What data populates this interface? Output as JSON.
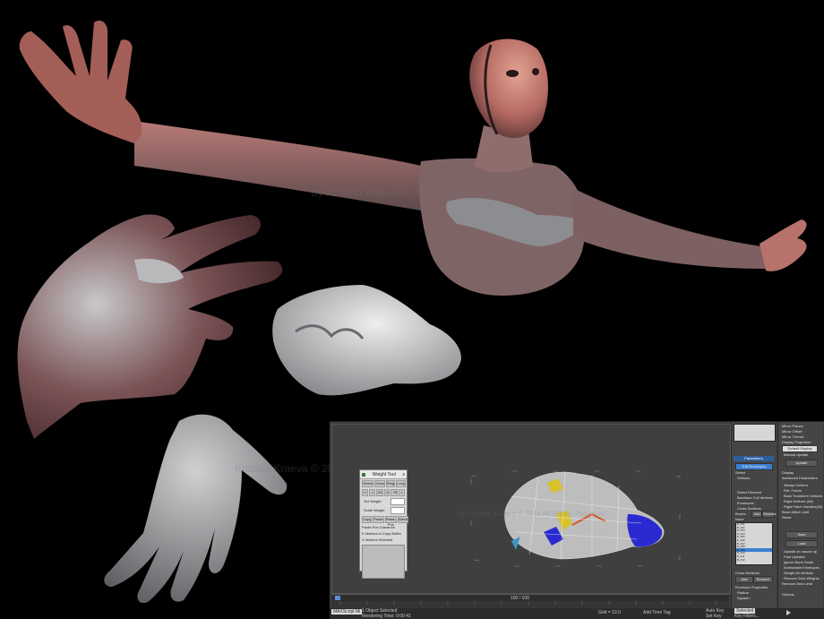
{
  "watermarks": {
    "center": "by Kristina Kraeva © 2014 All Rights Reserved",
    "lower_left": "Kristina Kraeva © 2014 All Rights Reserved",
    "viewport": "by Kristina Kraeva © 2014 All Rights Reserved"
  },
  "weight_tool": {
    "title": "Weight Tool",
    "close": "x",
    "row1": [
      "Shrink",
      "Grow",
      "Ring",
      "Loop"
    ],
    "row2": [
      "0",
      ".1",
      ".25",
      ".5",
      ".75",
      "1"
    ],
    "set_weight": "Set Weight",
    "scale_weight": "Scale Weight",
    "copy_paste": [
      "Copy",
      "Paste",
      "Paste-Pos",
      "Blend"
    ],
    "paste_pos_tolerance": "Paste-Pos Tolerance",
    "vertices_in_copy": "0 Vertices in Copy Buffer",
    "vertices_selected": "0 Vertices Selected"
  },
  "viewport": {
    "frame_label": "100 / 100"
  },
  "status": {
    "object_selected": "1 Object Selected",
    "rendering_time": "Rendering Time: 0:00:41",
    "max_script": "MAXScript Mi",
    "auto_key": "Auto Key",
    "set_key": "Set Key",
    "key_filters": "Key Filters...",
    "selected": "Selected",
    "add_time_tag": "Add Time Tag",
    "grid": "Grid = 10.0"
  },
  "command_panel": {
    "parameters_header": "Parameters",
    "edit_envelopes": "Edit Envelopes",
    "select": "Select",
    "vertices": "Vertices",
    "select_element": "Select Element",
    "backface_cull": "Backface Cull Vertices",
    "envelopes": "Envelopes",
    "cross_sections": "Cross Sections",
    "bones": "Bones:",
    "add": "Add",
    "remove": "Remove",
    "none": "None",
    "bone_list": [
      "B_001",
      "B_002",
      "B_003",
      "B_004",
      "B_005",
      "B_006",
      "B_007",
      "B_008",
      "B_009",
      "B_010",
      "B_011",
      "B_012"
    ],
    "cross_sections_header": "Cross Sections",
    "add2": "Add",
    "remove2": "Remove",
    "envelope_properties": "Envelope Properties",
    "radius": "Radius:",
    "squash": "Squash:"
  },
  "command_panel2": {
    "mirror_planes": "Mirror Planes",
    "mirror_offset": "Mirror Offset:",
    "mirror_thresh": "Mirror Thresh:",
    "display_projection": "Display Projection:",
    "default_display": "Default Display",
    "manual_update": "Manual Update",
    "update": "Update",
    "display": "Display",
    "advanced_parameters": "Advanced Parameters",
    "always_deform": "Always Deform",
    "ref_frame": "Ref. Frame",
    "rigid_vertices": "Rigid Vertices (All)",
    "rigid_patch_handles": "Rigid Patch Handles(All)",
    "back_transform": "Back Transform Vertices",
    "bone_affect_limit": "Bone Affect Limit",
    "reset": "Reset",
    "save": "Save",
    "load": "Load",
    "update_on_mouse_up": "Update on mouse up",
    "fast_updates": "Fast Updates",
    "ignore_bone_scale": "Ignore Bone Scale",
    "animatable_envelopes": "Animatable Envelopes",
    "weight_all_vertices": "Weight All Vertices",
    "remove_zero_weights": "Remove Zero Weights",
    "remove_zero_limit": "Remove Zero Limit",
    "gizmos": "Gizmos"
  },
  "colors": {
    "background": "#000000",
    "skin_highlight": "#b86a62",
    "skin_base": "#8f8f93",
    "max_panel": "#3c3c3c",
    "viewport": "#3f3f3f",
    "selection_blue": "#3b7fd1"
  },
  "icons": [
    "weight-tool-app-icon",
    "close-icon",
    "time-slider-icon",
    "play-icon"
  ]
}
